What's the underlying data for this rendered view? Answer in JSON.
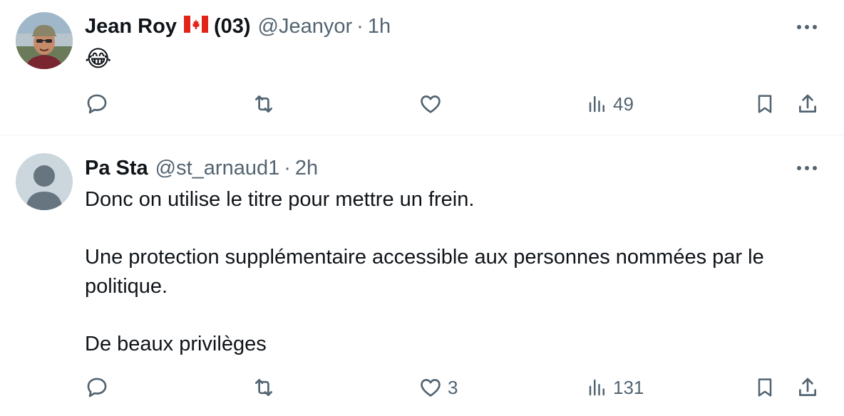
{
  "tweets": [
    {
      "author_name": "Jean Roy",
      "flag_icon": "canada-flag-icon",
      "badge": "(03)",
      "handle": "@Jeanyor",
      "separator": "·",
      "time": "1h",
      "emoji": "😂",
      "actions": {
        "reply_count": "",
        "retweet_count": "",
        "like_count": "",
        "views_count": "49"
      }
    },
    {
      "author_name": "Pa Sta",
      "handle": "@st_arnaud1",
      "separator": "·",
      "time": "2h",
      "text_lines": [
        "Donc on utilise le titre pour mettre un frein.",
        "Une protection supplémentaire accessible aux personnes nommées par le politique.",
        "De beaux privilèges"
      ],
      "actions": {
        "reply_count": "",
        "retweet_count": "",
        "like_count": "3",
        "views_count": "131"
      }
    }
  ],
  "colors": {
    "text_primary": "#0f1419",
    "text_secondary": "#536471",
    "divider": "#eff3f4",
    "default_avatar_bg": "#ccd6dd",
    "default_avatar_fg": "#66757f"
  }
}
